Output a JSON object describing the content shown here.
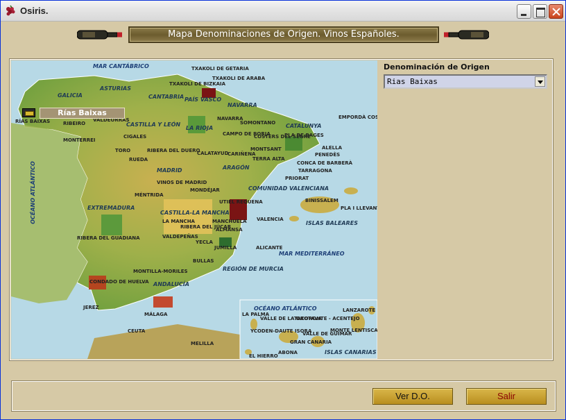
{
  "window": {
    "title": "Osiris."
  },
  "header": {
    "banner": "Mapa Denominaciones de Origen. Vinos Españoles."
  },
  "selector": {
    "label": "Denominación de Origen",
    "selected": "Rias Baixas"
  },
  "map": {
    "selected_tag": "Rías Baixas",
    "seas": [
      "MAR CANTÁBRICO",
      "OCÉANO ATLÁNTICO",
      "MAR MEDITERRÁNEO",
      "OCÉANO ATLÁNTICO"
    ],
    "regions": [
      "GALICIA",
      "ASTURIAS",
      "CANTABRIA",
      "PAÍS VASCO",
      "NAVARRA",
      "CATALUNYA",
      "CASTILLA Y LEÓN",
      "LA RIOJA",
      "ARAGÓN",
      "MADRID",
      "COMUNIDAD VALENCIANA",
      "EXTREMADURA",
      "CASTILLA-LA MANCHA",
      "REGIÓN DE MURCIA",
      "ANDALUCÍA",
      "ISLAS BALEARES",
      "ISLAS CANARIAS"
    ],
    "dos": [
      "TXAKOLI DE GETARIA",
      "TXAKOLI DE ARABA",
      "TXAKOLI DE BIZKAIA",
      "RÍAS BAIXAS",
      "RIBEIRO",
      "VALDEORRAS",
      "MONTERREI",
      "CIGALES",
      "TORO",
      "RUEDA",
      "RIBERA DEL DUERO",
      "NAVARRA",
      "CAMPO DE BORJA",
      "CALATAYUD",
      "CARIÑENA",
      "SOMONTANO",
      "COSTERS DEL SEGRE",
      "MONTSANT",
      "TERRA ALTA",
      "PRIORAT",
      "TARRAGONA",
      "CONCA DE BARBERÀ",
      "PENEDÈS",
      "ALELLA",
      "PLA DE BAGES",
      "EMPORDÀ COSTA BRAVA",
      "VINOS DE MADRID",
      "MONDÉJAR",
      "MÉNTRIDA",
      "UTIEL REQUENA",
      "VALENCIA",
      "LA MANCHA",
      "MANCHUELA",
      "RIBERA DEL JÚCAR",
      "ALMANSA",
      "VALDEPEÑAS",
      "YECLA",
      "JUMILLA",
      "ALICANTE",
      "BULLAS",
      "RIBERA DEL GUADIANA",
      "MONTILLA-MORILES",
      "CONDADO DE HUELVA",
      "JEREZ",
      "MÁLAGA",
      "BINISSALEM",
      "PLA I LLEVANT",
      "CEUTA",
      "MELILLA",
      "LA PALMA",
      "VALLE DE LA OROTAVA",
      "TACORONTE - ACENTEJO",
      "LANZAROTE",
      "YCODEN-DAUTE ISORA",
      "VALLE DE GÜIMAR",
      "MONTE LENTISCAL",
      "GRAN CANARIA",
      "ABONA",
      "EL HIERRO"
    ]
  },
  "buttons": {
    "ver": "Ver D.O.",
    "salir": "Salir"
  },
  "colors": {
    "banner_bg": "#6c5c2e",
    "salir_text": "#8b0000",
    "button_gold": "#c9a234"
  }
}
